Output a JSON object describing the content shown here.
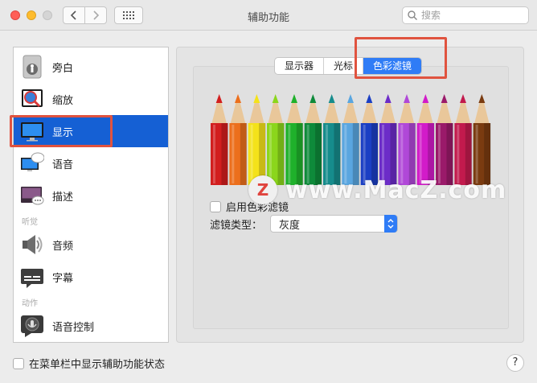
{
  "window": {
    "title": "辅助功能"
  },
  "toolbar": {
    "back_icon": "chevron-left-icon",
    "forward_icon": "chevron-right-icon",
    "grid_icon": "grid-icon"
  },
  "search": {
    "placeholder": "搜索",
    "value": ""
  },
  "sidebar": {
    "items": [
      {
        "label": "旁白",
        "icon": "voiceover-icon"
      },
      {
        "label": "缩放",
        "icon": "zoom-icon"
      },
      {
        "label": "显示",
        "icon": "display-icon",
        "selected": true
      },
      {
        "label": "语音",
        "icon": "speech-icon"
      },
      {
        "label": "描述",
        "icon": "descriptions-icon"
      },
      {
        "label": "音频",
        "icon": "audio-icon"
      },
      {
        "label": "字幕",
        "icon": "captions-icon"
      },
      {
        "label": "语音控制",
        "icon": "voice-control-icon"
      }
    ],
    "sections": [
      "听觉",
      "动作"
    ]
  },
  "tabs": [
    {
      "label": "显示器",
      "active": false
    },
    {
      "label": "光标",
      "active": false
    },
    {
      "label": "色彩滤镜",
      "active": true
    }
  ],
  "color_filter": {
    "enable_label": "启用色彩滤镜",
    "enabled": false,
    "type_label": "滤镜类型：",
    "type_value": "灰度"
  },
  "bottom": {
    "menubar_status_label": "在菜单栏中显示辅助功能状态",
    "checked": false
  },
  "help_label": "?",
  "watermark": {
    "badge": "Z",
    "text": "www.MacZ.com"
  },
  "colors": {
    "accent": "#2f7cf6",
    "selection": "#1560d4",
    "highlight_box": "#e0533f",
    "pencils": [
      "#d21e1e",
      "#ec6f1c",
      "#f4e21a",
      "#8bd61c",
      "#1fb12b",
      "#0e8a3a",
      "#168c8c",
      "#5aa6e0",
      "#1b3fc4",
      "#6c2cc8",
      "#b048d8",
      "#d21bc9",
      "#9a1a6a",
      "#c21a4d",
      "#7a3b10"
    ]
  }
}
